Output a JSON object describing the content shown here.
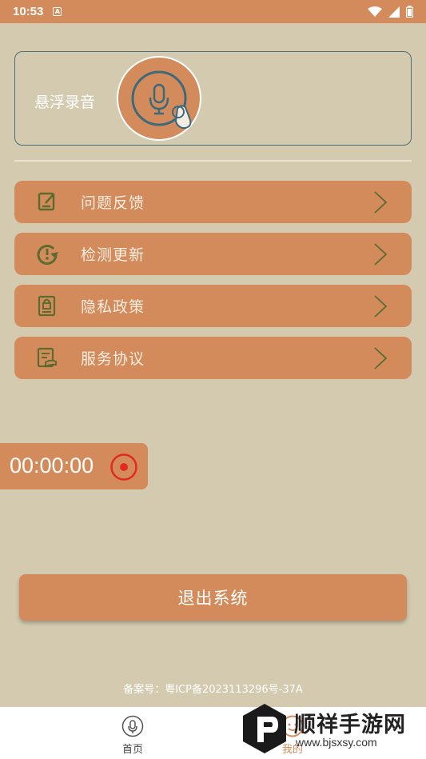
{
  "status_bar": {
    "time": "10:53",
    "notification_glyph": "A",
    "icons": [
      "wifi-icon",
      "signal-icon",
      "battery-icon"
    ]
  },
  "float_record": {
    "label": "悬浮录音",
    "icon": "microphone-touch-icon"
  },
  "menu": [
    {
      "label": "问题反馈",
      "icon": "feedback-icon"
    },
    {
      "label": "检测更新",
      "icon": "update-icon"
    },
    {
      "label": "隐私政策",
      "icon": "privacy-lock-icon"
    },
    {
      "label": "服务协议",
      "icon": "agreement-icon"
    }
  ],
  "timer": {
    "value": "00:00:00",
    "icon": "record-icon"
  },
  "exit_button": {
    "label": "退出系统"
  },
  "icp": "备案号：粤ICP备2023113296号-37A",
  "tabs": [
    {
      "label": "首页",
      "icon": "microphone-icon"
    },
    {
      "label": "我的",
      "icon": "face-icon"
    }
  ],
  "watermark": {
    "brand": "顺祥手游网",
    "site": "www.bjsxsy.com"
  },
  "colors": {
    "background": "#d4cab0",
    "accent": "#d48b5c",
    "icon_green": "#5c6b2e",
    "record_red": "#e02b1e"
  }
}
